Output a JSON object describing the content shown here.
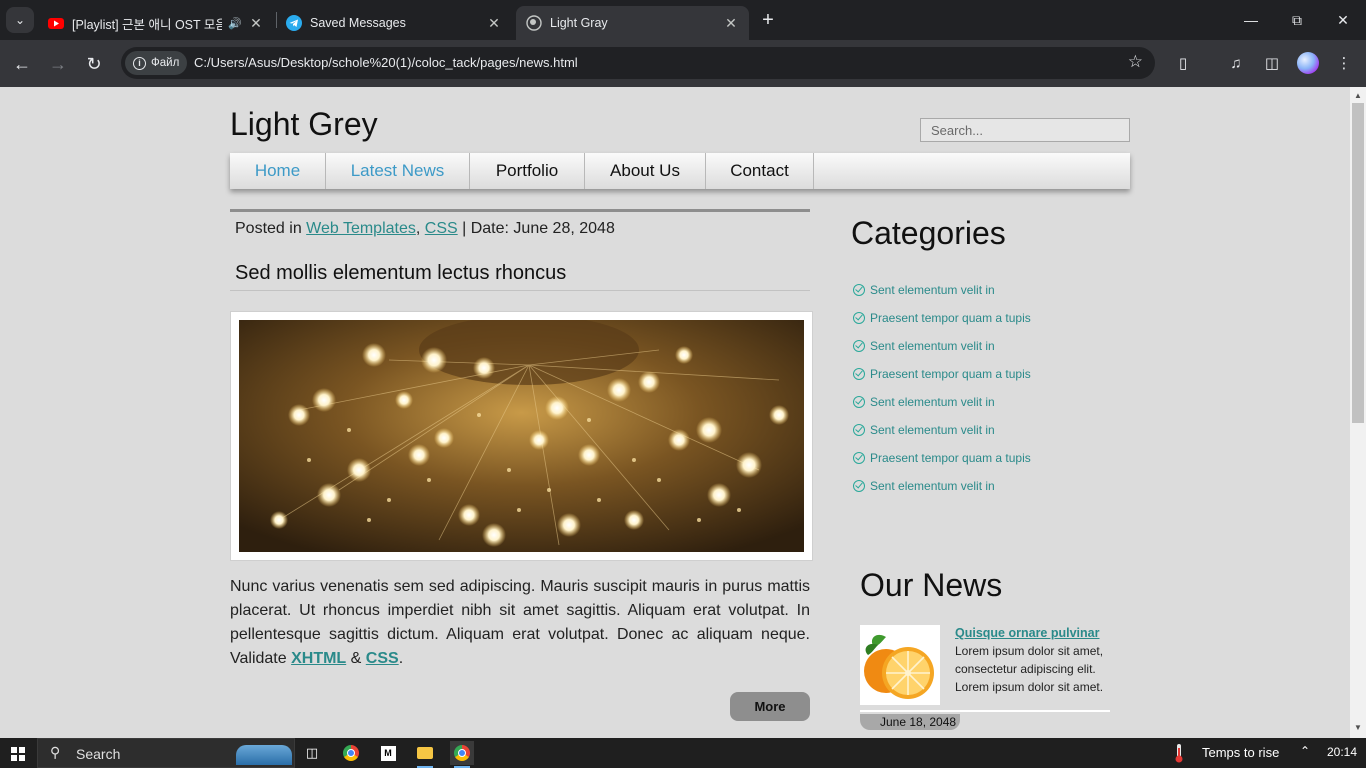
{
  "browser": {
    "tabs": [
      {
        "title": "[Playlist] 근본 애니 OST 모음",
        "icon": "youtube-icon",
        "audio": true
      },
      {
        "title": "Saved Messages",
        "icon": "telegram-icon"
      },
      {
        "title": "Light Gray",
        "icon": "globe-icon",
        "active": true
      }
    ],
    "site_chip": "Файл",
    "url": "C:/Users/Asus/Desktop/schole%20(1)/coloc_tack/pages/news.html"
  },
  "page": {
    "site_title": "Light Grey",
    "search_placeholder": "Search...",
    "menu": [
      {
        "label": "Home",
        "highlighted": true
      },
      {
        "label": "Latest News",
        "highlighted": true
      },
      {
        "label": "Portfolio",
        "highlighted": false
      },
      {
        "label": "About Us",
        "highlighted": false
      },
      {
        "label": "Contact",
        "highlighted": false
      }
    ],
    "post": {
      "meta_prefix": "Posted in",
      "cat1": "Web Templates",
      "comma": ",",
      "cat2": "CSS",
      "meta_date": "| Date: June 28, 2048",
      "title": "Sed mollis elementum lectus rhoncus",
      "body": "Nunc varius venenatis sem sed adipiscing. Mauris suscipit mauris in purus mattis placerat. Ut rhoncus imperdiet nibh sit amet sagittis. Aliquam erat volutpat. In pellentesque sagittis dictum. Aliquam erat volutpat. Donec ac aliquam neque. Validate",
      "xhtml": "XHTML",
      "amp": "&",
      "css": "CSS",
      "period": ".",
      "more": "More"
    },
    "sidebar": {
      "categories_title": "Categories",
      "categories": [
        "Sent elementum velit in",
        "Praesent tempor quam a tupis",
        "Sent elementum velit in",
        "Praesent tempor quam a tupis",
        "Sent elementum velit in",
        "Sent elementum velit in",
        "Praesent tempor quam a tupis",
        "Sent elementum velit in"
      ],
      "news_title": "Our News",
      "news_item": {
        "title": "Quisque ornare pulvinar",
        "excerpt": "Lorem ipsum dolor sit amet, consectetur adipiscing elit. Lorem ipsum dolor sit amet.",
        "date": "June 18, 2048"
      }
    }
  },
  "taskbar": {
    "search_label": "Search",
    "weather_text": "Temps to rise",
    "time": "20:14"
  },
  "colors": {
    "accent_link": "#2a8a8a",
    "menu_highlight": "#3d9ac7",
    "page_bg": "#dcdcdc"
  }
}
